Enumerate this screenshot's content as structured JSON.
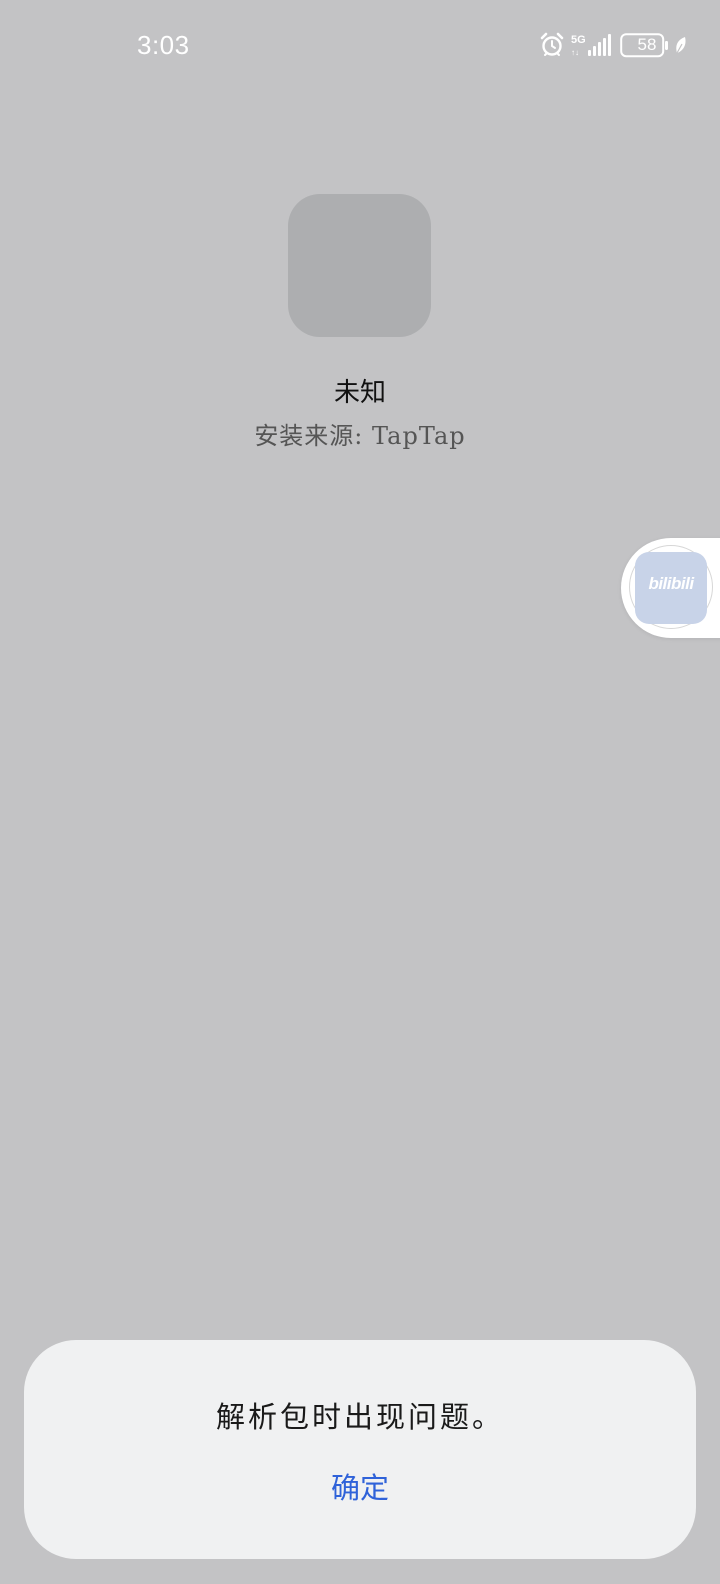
{
  "status_bar": {
    "time": "3:03",
    "battery_level": "58",
    "network": "5G",
    "icons": [
      "alarm-icon",
      "5g-signal-icon",
      "battery-icon",
      "battery-saver-leaf-icon"
    ]
  },
  "app_info": {
    "icon": "app-placeholder-icon",
    "name": "未知",
    "install_source": "安装来源: TapTap"
  },
  "floating_bubble": {
    "app_label": "bilibili",
    "app_color": "#c8d3e8"
  },
  "dialog": {
    "message": "解析包时出现问题。",
    "confirm_label": "确定",
    "confirm_color": "#2f62d9"
  }
}
